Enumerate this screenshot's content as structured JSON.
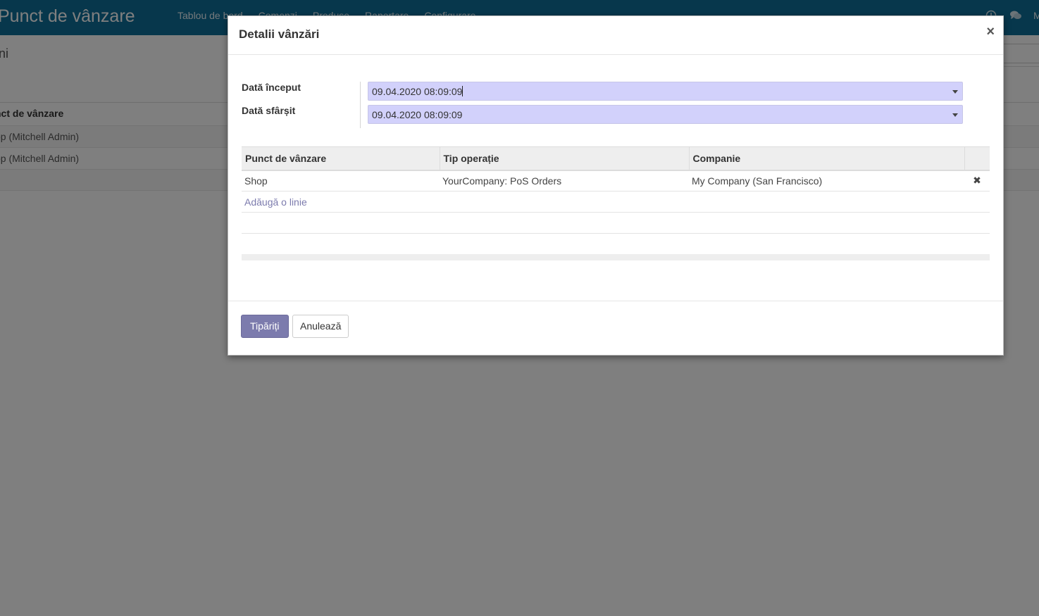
{
  "app": {
    "title": "Punct de vânzare",
    "nav": [
      "Tablou de bord",
      "Comenzi",
      "Produse",
      "Raportare",
      "Configurare"
    ],
    "user_initial": "M"
  },
  "background": {
    "breadcrumb_fragment": "ni",
    "list_header": "nct de vânzare",
    "rows": [
      "op (Mitchell Admin)",
      "op (Mitchell Admin)"
    ]
  },
  "dialog": {
    "title": "Detalii vânzări",
    "close_symbol": "×",
    "fields": {
      "start_label": "Dată început",
      "start_value": "09.04.2020 08:09:09",
      "end_label": "Dată sfârșit",
      "end_value": "09.04.2020 08:09:09"
    },
    "table": {
      "columns": [
        "Punct de vânzare",
        "Tip operație",
        "Companie"
      ],
      "rows": [
        {
          "pos": "Shop",
          "operation": "YourCompany: PoS Orders",
          "company": "My Company (San Francisco)"
        }
      ],
      "add_line": "Adăugă o linie",
      "delete_symbol": "✖"
    },
    "buttons": {
      "print": "Tipăriți",
      "cancel": "Anulează"
    }
  }
}
